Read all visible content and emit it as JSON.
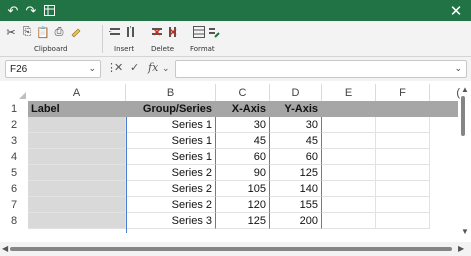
{
  "titlebar": {
    "undo_icon": "undo-icon",
    "redo_icon": "redo-icon",
    "sheet_icon": "sheet-icon",
    "close_glyph": "✕"
  },
  "ribbon": {
    "groups": [
      {
        "label": "Clipboard"
      },
      {
        "label": "Insert"
      },
      {
        "label": "Delete"
      },
      {
        "label": "Format"
      }
    ]
  },
  "formula_bar": {
    "name_box": "F26",
    "fx": "fx",
    "value": ""
  },
  "columns": [
    "A",
    "B",
    "C",
    "D",
    "E",
    "F",
    "("
  ],
  "rows": [
    {
      "num": "1",
      "a": "Label",
      "b": "Group/Series",
      "c": "X-Axis",
      "d": "Y-Axis"
    },
    {
      "num": "2",
      "a": "",
      "b": "Series 1",
      "c": "30",
      "d": "30"
    },
    {
      "num": "3",
      "a": "",
      "b": "Series 1",
      "c": "45",
      "d": "45"
    },
    {
      "num": "4",
      "a": "",
      "b": "Series 1",
      "c": "60",
      "d": "60"
    },
    {
      "num": "5",
      "a": "",
      "b": "Series 2",
      "c": "90",
      "d": "125"
    },
    {
      "num": "6",
      "a": "",
      "b": "Series 2",
      "c": "105",
      "d": "140"
    },
    {
      "num": "7",
      "a": "",
      "b": "Series 2",
      "c": "120",
      "d": "155"
    },
    {
      "num": "8",
      "a": "",
      "b": "Series 3",
      "c": "125",
      "d": "200"
    }
  ],
  "colors": {
    "titlebar": "#217346",
    "header_row": "#a6a6a6",
    "label_col": "#d9d9d9"
  }
}
